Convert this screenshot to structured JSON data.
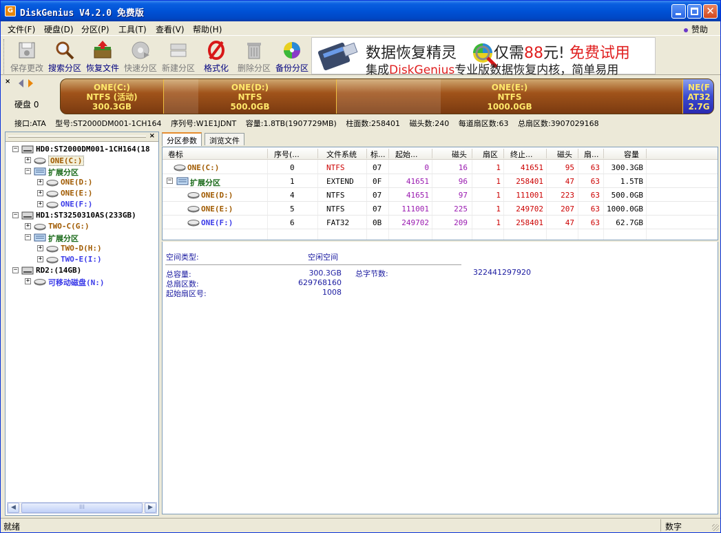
{
  "window": {
    "title": "DiskGenius V4.2.0 免费版",
    "icon_letter": "G",
    "min_icon": "minimize-icon",
    "max_icon": "maximize-icon",
    "close_icon": "close-icon"
  },
  "menu": {
    "items": [
      "文件(F)",
      "硬盘(D)",
      "分区(P)",
      "工具(T)",
      "查看(V)",
      "帮助(H)"
    ],
    "donate": "赞助"
  },
  "toolbar": {
    "buttons": [
      {
        "label": "保存更改",
        "icon": "save-icon",
        "enabled": false
      },
      {
        "label": "搜索分区",
        "icon": "magnifier-icon",
        "enabled": true
      },
      {
        "label": "恢复文件",
        "icon": "recover-box-icon",
        "enabled": true
      },
      {
        "label": "快速分区",
        "icon": "quick-disk-icon",
        "enabled": false
      },
      {
        "label": "新建分区",
        "icon": "new-partition-icon",
        "enabled": false
      },
      {
        "label": "格式化",
        "icon": "format-icon",
        "enabled": true
      },
      {
        "label": "删除分区",
        "icon": "trash-icon",
        "enabled": false
      },
      {
        "label": "备份分区",
        "icon": "backup-disc-icon",
        "enabled": true
      }
    ],
    "ad": {
      "line1_a": "数据恢复精灵",
      "line1_b": "仅需",
      "line1_price": "88",
      "line1_c": "元!",
      "line1_trial": "免费试用",
      "line2_a": "集成",
      "line2_brand": "DiskGenius",
      "line2_b": "专业版数据恢复内核，简单易用"
    }
  },
  "diskbar": {
    "disk_label": "硬盘 0",
    "segments": [
      {
        "name": "ONE(C:)",
        "fs": "NTFS (活动)",
        "size": "300.3GB",
        "used_fraction": 0.0
      },
      {
        "name": "ONE(D:)",
        "fs": "NTFS",
        "size": "500.0GB",
        "used_fraction": 0.2
      },
      {
        "name": "ONE(E:)",
        "fs": "NTFS",
        "size": "1000.0GB",
        "used_fraction": 0.3
      },
      {
        "name": "NE(F",
        "fs": "AT32",
        "size": "2.7G",
        "used_fraction": 0.0
      }
    ],
    "colors": {
      "ntfs": "#a0531a",
      "fat32": "#3a4ad0",
      "label": "#ffe76a"
    }
  },
  "disk_info": {
    "interface": "接口:ATA",
    "model": "型号:ST2000DM001-1CH164",
    "serial": "序列号:W1E1JDNT",
    "capacity": "容量:1.8TB(1907729MB)",
    "cylinders": "柱面数:258401",
    "heads": "磁头数:240",
    "sectors_per_track": "每道扇区数:63",
    "total_sectors": "总扇区数:3907029168"
  },
  "tree": {
    "nodes": [
      {
        "text": "HD0:ST2000DM001-1CH164(18",
        "color": "black",
        "depth": 0,
        "exp": "−",
        "icon": "hard-disk-icon"
      },
      {
        "text": "ONE(C:)",
        "color": "orange",
        "depth": 1,
        "exp": "+",
        "icon": "partition-icon",
        "selected": true
      },
      {
        "text": "扩展分区",
        "color": "green",
        "depth": 1,
        "exp": "−",
        "icon": "extended-partition-icon"
      },
      {
        "text": "ONE(D:)",
        "color": "orange",
        "depth": 2,
        "exp": "+",
        "icon": "partition-icon"
      },
      {
        "text": "ONE(E:)",
        "color": "orange",
        "depth": 2,
        "exp": "+",
        "icon": "partition-icon"
      },
      {
        "text": "ONE(F:)",
        "color": "blue",
        "depth": 2,
        "exp": "+",
        "icon": "partition-icon"
      },
      {
        "text": "HD1:ST3250310AS(233GB)",
        "color": "black",
        "depth": 0,
        "exp": "−",
        "icon": "hard-disk-icon"
      },
      {
        "text": "TWO-C(G:)",
        "color": "orange",
        "depth": 1,
        "exp": "+",
        "icon": "partition-icon"
      },
      {
        "text": "扩展分区",
        "color": "green",
        "depth": 1,
        "exp": "−",
        "icon": "extended-partition-icon"
      },
      {
        "text": "TWO-D(H:)",
        "color": "orange",
        "depth": 2,
        "exp": "+",
        "icon": "partition-icon"
      },
      {
        "text": "TWO-E(I:)",
        "color": "blue",
        "depth": 2,
        "exp": "+",
        "icon": "partition-icon"
      },
      {
        "text": "RD2:(14GB)",
        "color": "black",
        "depth": 0,
        "exp": "−",
        "icon": "hard-disk-icon"
      },
      {
        "text": "可移动磁盘(N:)",
        "color": "blue",
        "depth": 1,
        "exp": "+",
        "icon": "partition-icon"
      }
    ],
    "scroll_thumb": "III"
  },
  "tabs": [
    "分区参数",
    "浏览文件"
  ],
  "grid": {
    "columns": [
      "卷标",
      "序号(...",
      "文件系统",
      "标...",
      "起始...",
      "磁头",
      "扇区",
      "终止...",
      "磁头",
      "扇...",
      "容量"
    ],
    "rows": [
      {
        "label": "ONE(C:)",
        "color": "orange",
        "indent": 0,
        "exp": "",
        "seq": "0",
        "fs": "NTFS",
        "fs_red": true,
        "id": "07",
        "start_cyl": "0",
        "start_head": "16",
        "start_sec": "1",
        "end_cyl": "41651",
        "end_head": "95",
        "end_sec": "63",
        "size": "300.3GB"
      },
      {
        "label": "扩展分区",
        "color": "green",
        "indent": 0,
        "exp": "−",
        "seq": "1",
        "fs": "EXTEND",
        "fs_red": false,
        "id": "0F",
        "start_cyl": "41651",
        "start_head": "96",
        "start_sec": "1",
        "end_cyl": "258401",
        "end_head": "47",
        "end_sec": "63",
        "size": "1.5TB"
      },
      {
        "label": "ONE(D:)",
        "color": "orange",
        "indent": 1,
        "exp": "",
        "seq": "4",
        "fs": "NTFS",
        "fs_red": false,
        "id": "07",
        "start_cyl": "41651",
        "start_head": "97",
        "start_sec": "1",
        "end_cyl": "111001",
        "end_head": "223",
        "end_sec": "63",
        "size": "500.0GB"
      },
      {
        "label": "ONE(E:)",
        "color": "orange",
        "indent": 1,
        "exp": "",
        "seq": "5",
        "fs": "NTFS",
        "fs_red": false,
        "id": "07",
        "start_cyl": "111001",
        "start_head": "225",
        "start_sec": "1",
        "end_cyl": "249702",
        "end_head": "207",
        "end_sec": "63",
        "size": "1000.0GB"
      },
      {
        "label": "ONE(F:)",
        "color": "blue",
        "indent": 1,
        "exp": "",
        "seq": "6",
        "fs": "FAT32",
        "fs_red": false,
        "id": "0B",
        "start_cyl": "249702",
        "start_head": "209",
        "start_sec": "1",
        "end_cyl": "258401",
        "end_head": "47",
        "end_sec": "63",
        "size": "62.7GB"
      }
    ]
  },
  "info": {
    "space_type_label": "空间类型:",
    "space_type_value": "空闲空间",
    "total_capacity_label": "总容量:",
    "total_capacity_value": "300.3GB",
    "total_bytes_label": "总字节数:",
    "total_bytes_value": "322441297920",
    "total_sectors_label": "总扇区数:",
    "total_sectors_value": "629768160",
    "start_sector_label": "起始扇区号:",
    "start_sector_value": "1008"
  },
  "status": {
    "left": "就绪",
    "right": "数字"
  }
}
